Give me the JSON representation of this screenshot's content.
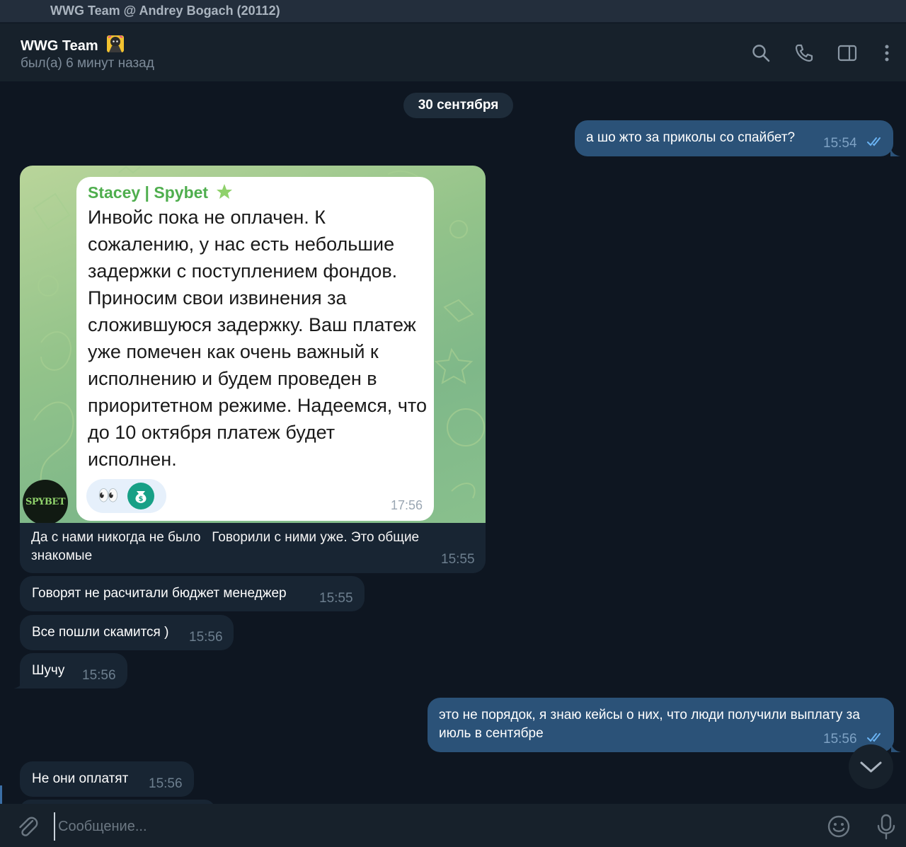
{
  "window": {
    "title": "WWG Team @ Andrey Bogach (20112)"
  },
  "header": {
    "name": "WWG Team",
    "status": "был(а) 6 минут назад",
    "icons": [
      "search-icon",
      "phone-icon",
      "sidebar-toggle-icon",
      "more-vertical-icon"
    ]
  },
  "chat": {
    "date_separator": "30 сентября",
    "messages": [
      {
        "id": "m1",
        "direction": "out",
        "text": "а шо жто за приколы со спайбет?",
        "time": "15:54",
        "read": true
      },
      {
        "id": "m2",
        "direction": "in",
        "type": "photo",
        "forwarded_quote": {
          "sender": "Stacey | Spybet",
          "text": "Инвойс пока не оплачен. К сожалению, у нас есть небольшие задержки с поступлением фондов. Приносим свои извинения за сложившуюся задержку. Ваш платеж уже помечен как очень важный к исполнению и будем проведен в приоритетном режиме. Надеемся, что до 10 октября платеж будет исполнен.",
          "time": "17:56",
          "reactions": [
            "👀",
            "money-bag-icon"
          ],
          "avatar_label": "SPYBET"
        },
        "caption": "Да с нами никогда не было   Говорили с ними уже. Это общие знакомые",
        "time": "15:55"
      },
      {
        "id": "m3",
        "direction": "in",
        "text": "Говорят не расчитали бюджет менеджер",
        "time": "15:55"
      },
      {
        "id": "m4",
        "direction": "in",
        "text": "Все пошли скамится )",
        "time": "15:56"
      },
      {
        "id": "m5",
        "direction": "in",
        "text": "Шучу",
        "time": "15:56"
      },
      {
        "id": "m6",
        "direction": "out",
        "text": "это не порядок, я знаю кейсы о них, что люди получили выплату за июль в сентябре",
        "time": "15:56",
        "read": true
      },
      {
        "id": "m7",
        "direction": "in",
        "text": "Не они оплатят",
        "time": "15:56"
      }
    ]
  },
  "composer": {
    "placeholder": "Сообщение...",
    "icons": [
      "attach-icon",
      "emoji-icon",
      "microphone-icon"
    ]
  },
  "colors": {
    "background": "#0e1621",
    "header": "#17212b",
    "bubble_in": "#182533",
    "bubble_out": "#2b5278",
    "accent_green": "#4fae4e",
    "read_ticks": "#6ab3f3"
  }
}
